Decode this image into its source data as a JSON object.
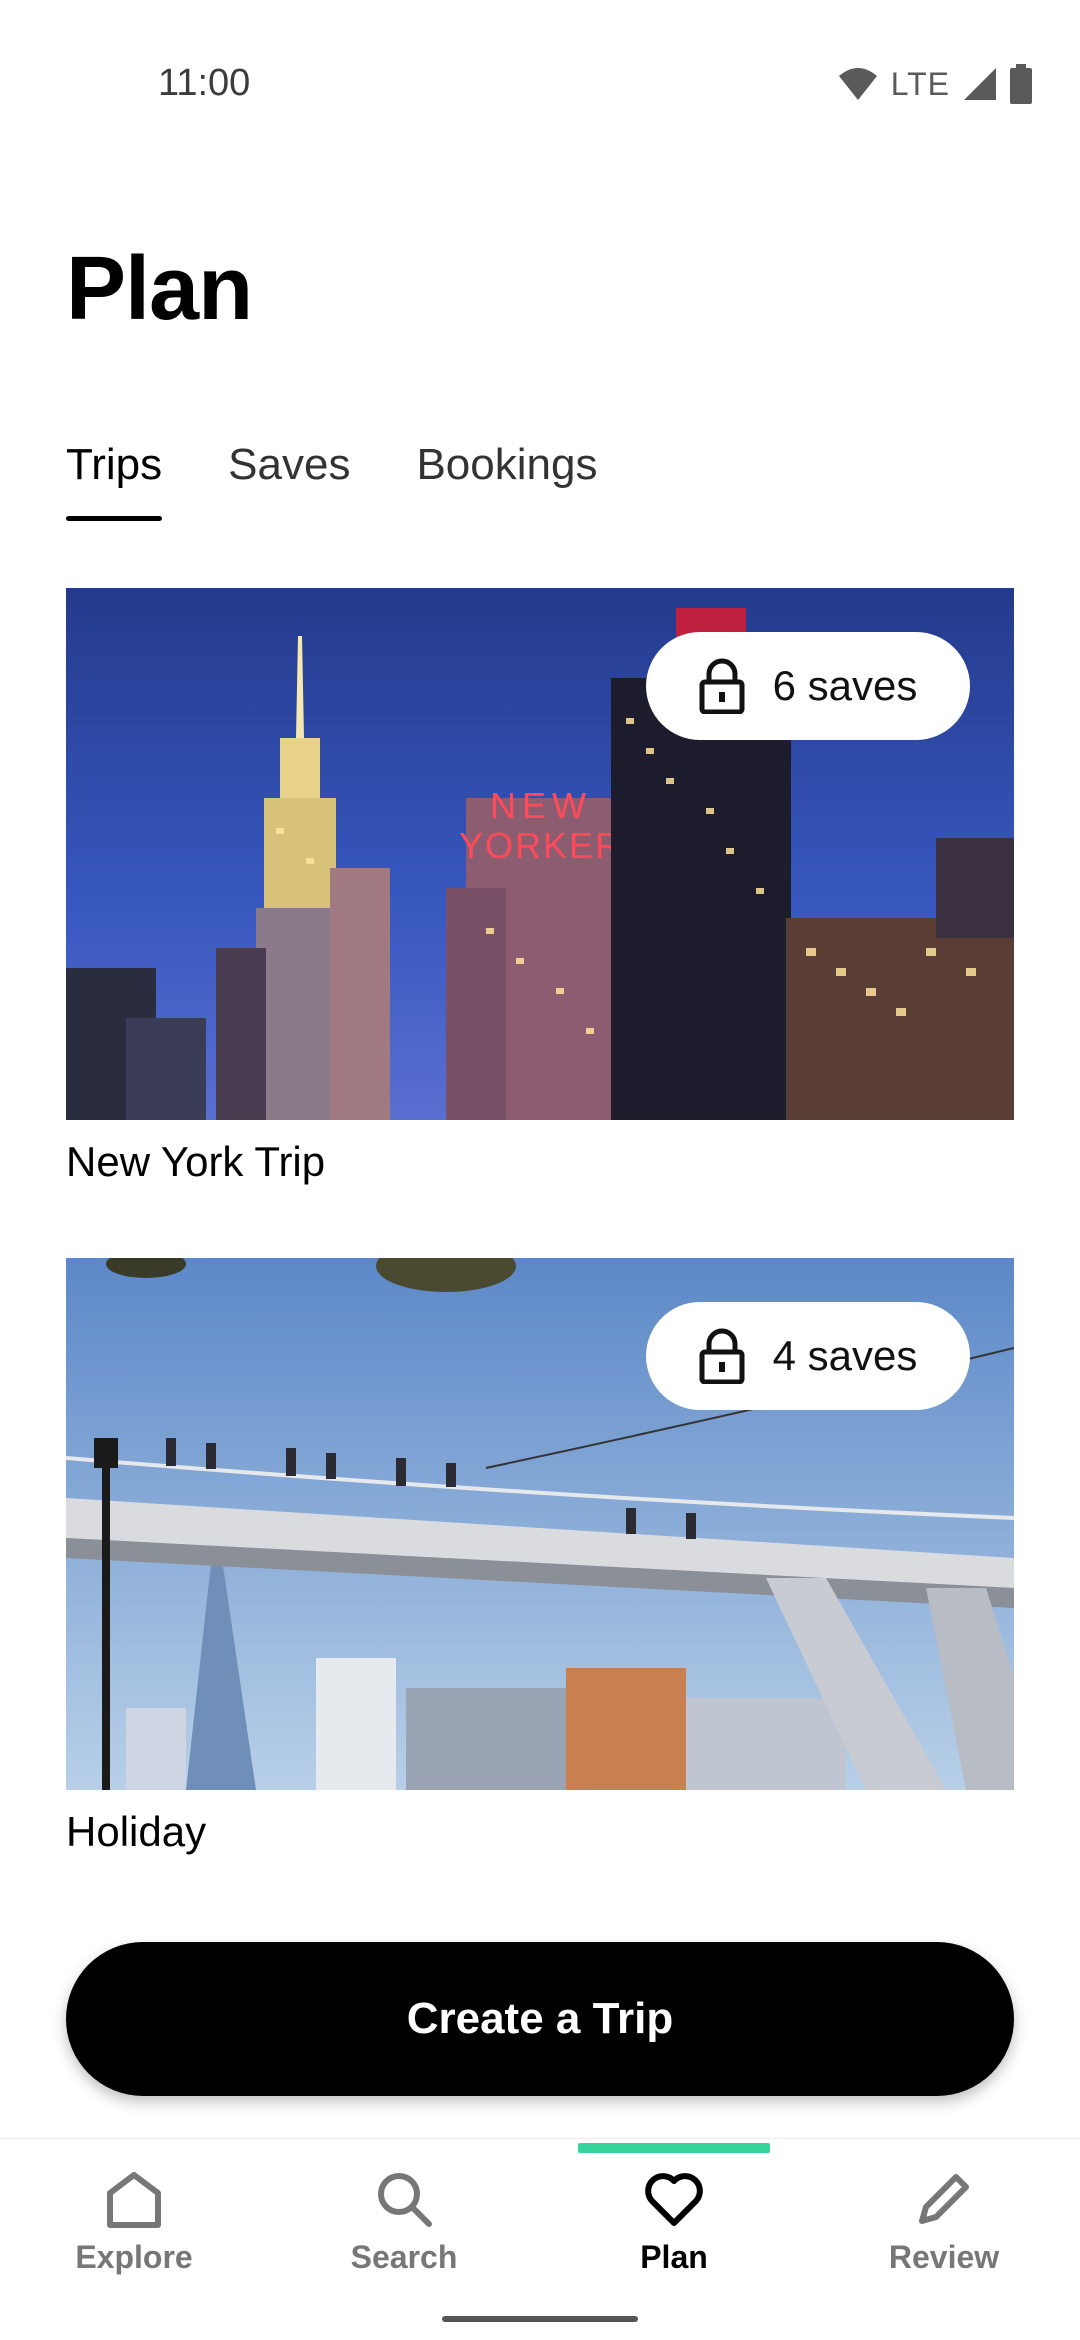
{
  "status_bar": {
    "time": "11:00",
    "network": "LTE",
    "icons": [
      "wifi-icon",
      "signal-icon",
      "battery-icon"
    ]
  },
  "page": {
    "title": "Plan"
  },
  "tabs": [
    {
      "label": "Trips",
      "active": true
    },
    {
      "label": "Saves",
      "active": false
    },
    {
      "label": "Bookings",
      "active": false
    }
  ],
  "trips": [
    {
      "title": "New York Trip",
      "saves": "6 saves",
      "lock_icon": "lock-icon",
      "sign_text": [
        "NEW",
        "YORKER"
      ]
    },
    {
      "title": "Holiday",
      "saves": "4 saves",
      "lock_icon": "lock-icon"
    }
  ],
  "create_button": {
    "label": "Create a Trip"
  },
  "bottom_nav": {
    "items": [
      {
        "label": "Explore",
        "icon": "home-icon",
        "active": false
      },
      {
        "label": "Search",
        "icon": "search-icon",
        "active": false
      },
      {
        "label": "Plan",
        "icon": "heart-icon",
        "active": true
      },
      {
        "label": "Review",
        "icon": "pencil-icon",
        "active": false
      }
    ],
    "indicator_color": "#34d399"
  }
}
